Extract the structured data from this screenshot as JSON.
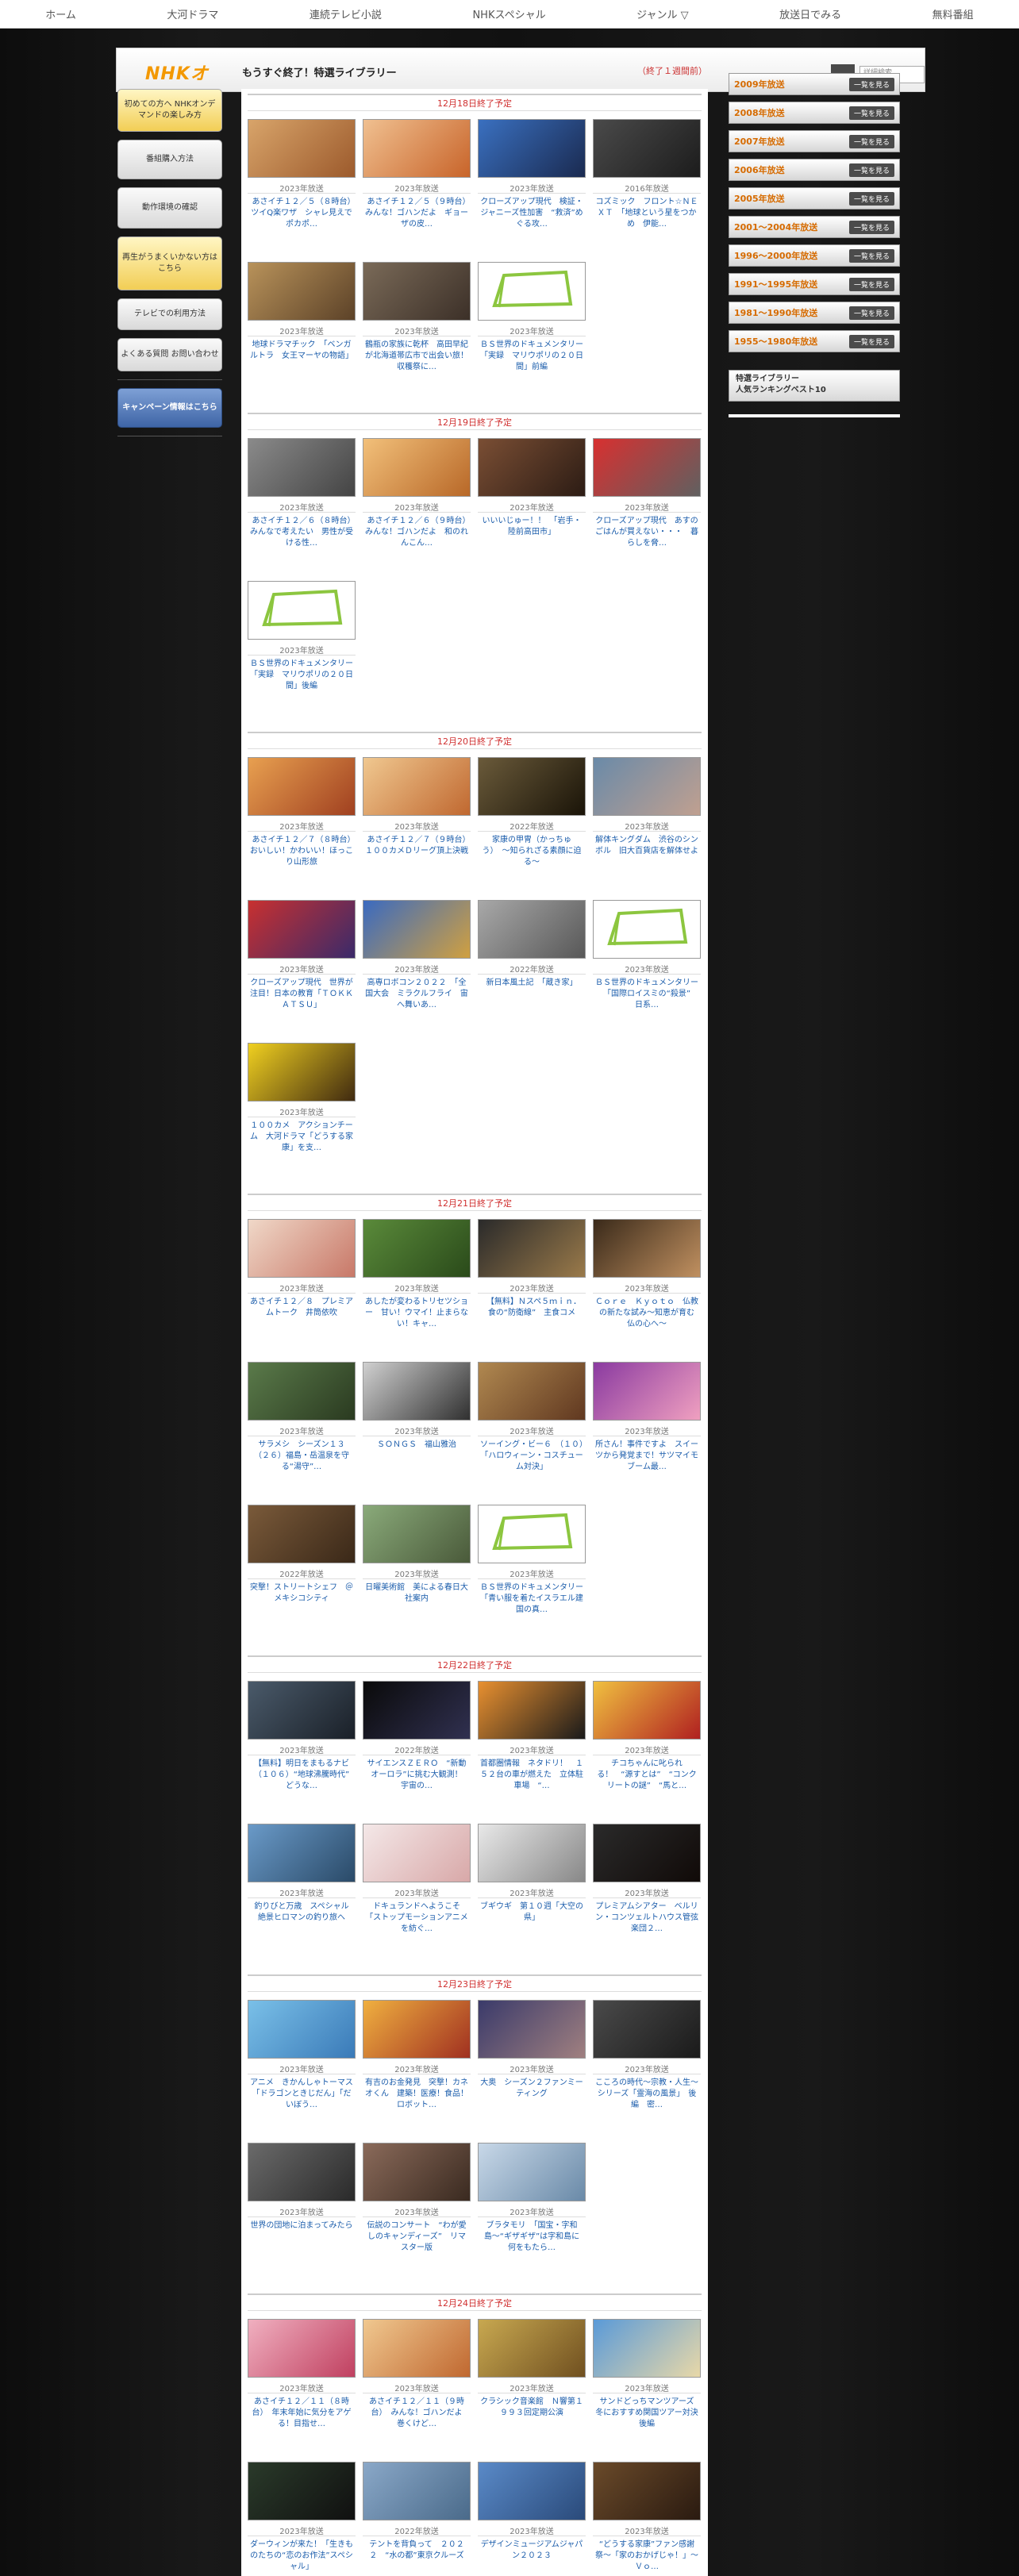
{
  "topnav": [
    "ホーム",
    "大河ドラマ",
    "連続テレビ小説",
    "NHKスペシャル",
    "ジャンル",
    "放送日でみる",
    "無料番組"
  ],
  "header": {
    "logo": "NHKオ",
    "title": "もうすぐ終了！特選ライブラリー",
    "sub": "（終了１週間前）",
    "search_placeholder": "詳細検索"
  },
  "sidebar": [
    "初めての方へ NHKオンデマンドの楽しみ方",
    "番組購入方法",
    "動作環境の確認",
    "再生がうまくいかない方はこちら",
    "テレビでの利用方法",
    "よくある質問 お問い合わせ",
    "キャンペーン情報はこちら"
  ],
  "rightnav": {
    "years": [
      "2009年放送",
      "2008年放送",
      "2007年放送",
      "2006年放送",
      "2005年放送",
      "2001〜2004年放送",
      "1996〜2000年放送",
      "1991〜1995年放送",
      "1981〜1990年放送",
      "1955〜1980年放送"
    ],
    "button": "一覧を見る",
    "ranking_l1": "特選ライブラリー",
    "ranking_l2": "人気ランキングベスト10"
  },
  "days": [
    {
      "label": "12月18日終了予定",
      "items": [
        {
          "year": "2023年放送",
          "title": "あさイチ１２／５（８時台）　ツイQ楽ワザ　シャレ見えでポカポ…",
          "c1": "#d8a46a",
          "c2": "#9c5a2c"
        },
        {
          "year": "2023年放送",
          "title": "あさイチ１２／５（９時台）　みんな！ゴハンだよ　ギョーザの皮…",
          "c1": "#f0c090",
          "c2": "#c8642a"
        },
        {
          "year": "2023年放送",
          "title": "クローズアップ現代　検証・ジャニーズ性加害　“救済”めぐる攻…",
          "c1": "#3a70c0",
          "c2": "#1a2a50"
        },
        {
          "year": "2016年放送",
          "title": "コズミック　フロント☆ＮＥＸＴ　「地球という星をつかめ　伊能…",
          "c1": "#4a4a4a",
          "c2": "#1c1c1c"
        },
        {
          "year": "2023年放送",
          "title": "地球ドラマチック　「ベンガルトラ　女王マーヤの物語」",
          "c1": "#b8925a",
          "c2": "#5c4228"
        },
        {
          "year": "2023年放送",
          "title": "鶴瓶の家族に乾杯　高田早紀が北海道帯広市で出会い旅！収穫祭に…",
          "c1": "#7a6a58",
          "c2": "#3c3028"
        },
        {
          "year": "2023年放送",
          "title": "ＢＳ世界のドキュメンタリー　「実録　マリウポリの２０日間」前編",
          "doc": "true"
        }
      ]
    },
    {
      "label": "12月19日終了予定",
      "items": [
        {
          "year": "2023年放送",
          "title": "あさイチ１２／６（８時台）　みんなで考えたい　男性が受ける性…",
          "c1": "#8a8a8a",
          "c2": "#444"
        },
        {
          "year": "2023年放送",
          "title": "あさイチ１２／６（９時台）　みんな！ゴハンだよ　和のれんこん…",
          "c1": "#f2c07a",
          "c2": "#b86828"
        },
        {
          "year": "2023年放送",
          "title": "いいいじゅー！！　「岩手・陸前高田市」",
          "c1": "#7a4e34",
          "c2": "#2c1c14"
        },
        {
          "year": "2023年放送",
          "title": "クローズアップ現代　あすのごはんが買えない・・・　暮らしを脅…",
          "c1": "#d83030",
          "c2": "#606060"
        },
        {
          "year": "2023年放送",
          "title": "ＢＳ世界のドキュメンタリー　「実録　マリウポリの２０日間」後編",
          "doc": "true"
        }
      ]
    },
    {
      "label": "12月20日終了予定",
      "items": [
        {
          "year": "2023年放送",
          "title": "あさイチ１２／７（８時台）　おいしい！かわいい！ほっこり山形旅",
          "c1": "#e8a050",
          "c2": "#a04020"
        },
        {
          "year": "2023年放送",
          "title": "あさイチ１２／７（９時台）　１００カメＤリーグ頂上決戦",
          "c1": "#f0c890",
          "c2": "#c06830"
        },
        {
          "year": "2022年放送",
          "title": "家康の甲冑（かっちゅう）　〜知られざる素顔に迫る〜",
          "c1": "#6a5a3a",
          "c2": "#1a1408"
        },
        {
          "year": "2023年放送",
          "title": "解体キングダム　渋谷のシンボル　旧大百貨店を解体せよ",
          "c1": "#6a8aa8",
          "c2": "#c0a090"
        },
        {
          "year": "2023年放送",
          "title": "クローズアップ現代　世界が注目！日本の教育「ＴＯＫＫＡＴＳＵ」",
          "c1": "#c83030",
          "c2": "#3a2a6a"
        },
        {
          "year": "2023年放送",
          "title": "高専ロボコン２０２２　「全国大会　ミラクルフライ　宙へ舞いあ…",
          "c1": "#3a6ac0",
          "c2": "#d0a040"
        },
        {
          "year": "2022年放送",
          "title": "新日本風土記　「蔵き家」",
          "c1": "#a8a8a8",
          "c2": "#585858"
        },
        {
          "year": "2023年放送",
          "title": "ＢＳ世界のドキュメンタリー　「国際ロイスミの“殺景”　日系…",
          "doc": "true"
        },
        {
          "year": "2023年放送",
          "title": "１００カメ　アクションチーム　大河ドラマ「どうする家康」を支…",
          "c1": "#f0d020",
          "c2": "#402a10"
        }
      ]
    },
    {
      "label": "12月21日終了予定",
      "items": [
        {
          "year": "2023年放送",
          "title": "あさイチ１２／８　プレミアムトーク　井筒依吹",
          "c1": "#f0d8c8",
          "c2": "#c87868"
        },
        {
          "year": "2023年放送",
          "title": "あしたが変わるトリセツショー　甘い！ウマイ！止まらない！キャ…",
          "c1": "#5a8a3a",
          "c2": "#2a4a1a"
        },
        {
          "year": "2023年放送",
          "title": "【無料】Ｎスペ５ｍｉｎ．　食の“防衛線”　主食コメ",
          "c1": "#2a2a2a",
          "c2": "#9a7a4a"
        },
        {
          "year": "2023年放送",
          "title": "Ｃｏｒｅ　Ｋｙｏｔｏ　仏教の新たな試み〜知恵が育む　仏の心へ〜",
          "c1": "#3a2a1a",
          "c2": "#c09060"
        },
        {
          "year": "2023年放送",
          "title": "サラメシ　シーズン１３　（２６）福島・岳温泉を守る“湯守”…",
          "c1": "#5a7a4a",
          "c2": "#2a3a20"
        },
        {
          "year": "2023年放送",
          "title": "ＳＯＮＧＳ　福山雅治",
          "c1": "#d0d0d0",
          "c2": "#303030"
        },
        {
          "year": "2023年放送",
          "title": "ソーイング・ビー６　（１０）「ハロウィーン・コスチューム対決」",
          "c1": "#b08850",
          "c2": "#603820"
        },
        {
          "year": "2023年放送",
          "title": "所さん！事件ですよ　スイーツから発覚まで！サツマイモブーム最…",
          "c1": "#8a3aa0",
          "c2": "#f0a0c0"
        },
        {
          "year": "2022年放送",
          "title": "突撃！ストリートシェフ　＠メキシコシティ",
          "c1": "#7a5a3a",
          "c2": "#3a2818"
        },
        {
          "year": "2023年放送",
          "title": "日曜美術館　美による春日大社案内",
          "c1": "#8aaa7a",
          "c2": "#4a5a3a"
        },
        {
          "year": "2023年放送",
          "title": "ＢＳ世界のドキュメンタリー　「青い服を着たイスラエル建国の真…",
          "doc": "true"
        }
      ]
    },
    {
      "label": "12月22日終了予定",
      "items": [
        {
          "year": "2023年放送",
          "title": "【無料】明日をまもるナビ　（１０６）“地球沸騰時代”　どうな…",
          "c1": "#4a5a6a",
          "c2": "#1a2028"
        },
        {
          "year": "2022年放送",
          "title": "サイエンスＺＥＲＯ　“新動オーロラ”に挑む大観測！　宇宙の…",
          "c1": "#0a0a0a",
          "c2": "#303050"
        },
        {
          "year": "2023年放送",
          "title": "首都圏情報　ネタドリ！　１５２台の車が燃えた　立体駐車場　“…",
          "c1": "#e89030",
          "c2": "#1a1a1a"
        },
        {
          "year": "2023年放送",
          "title": "チコちゃんに叱られる！　“源すとは”　“コンクリートの謎”　“馬と…",
          "c1": "#f0c040",
          "c2": "#b02020"
        },
        {
          "year": "2023年放送",
          "title": "釣りびと万歳　スペシャル　絶景ヒロマンの釣り旅へ",
          "c1": "#6a9ac8",
          "c2": "#2a4a68"
        },
        {
          "year": "2023年放送",
          "title": "ドキュランドへようこそ　「ストップモーションアニメを紡ぐ…",
          "c1": "#f4e8e8",
          "c2": "#d8a8a8"
        },
        {
          "year": "2023年放送",
          "title": "ブギウギ　第１０週「大空の県」",
          "c1": "#e8e8e8",
          "c2": "#888"
        },
        {
          "year": "2023年放送",
          "title": "プレミアムシアター　ベルリン・コンツェルトハウス管弦楽団２…",
          "c1": "#2a2a2a",
          "c2": "#100a08"
        }
      ]
    },
    {
      "label": "12月23日終了予定",
      "items": [
        {
          "year": "2023年放送",
          "title": "アニメ　きかんしゃトーマス　「ドラゴンときじだん」「だいぼう…",
          "c1": "#7ac0e8",
          "c2": "#3a7ab8"
        },
        {
          "year": "2023年放送",
          "title": "有吉のお金発見　突撃！カネオくん　建築！医療！食品！ロボット…",
          "c1": "#f0b040",
          "c2": "#a03020"
        },
        {
          "year": "2023年放送",
          "title": "大奥　シーズン２ファンミーティング",
          "c1": "#3a3a6a",
          "c2": "#a08080"
        },
        {
          "year": "2023年放送",
          "title": "こころの時代〜宗教・人生〜　シリーズ「霊海の風景」　後編　密…",
          "c1": "#4a4a4a",
          "c2": "#1a1a1a"
        },
        {
          "year": "2023年放送",
          "title": "世界の団地に泊まってみたら",
          "c1": "#6a6a6a",
          "c2": "#2a2a2a"
        },
        {
          "year": "2023年放送",
          "title": "伝説のコンサート　“わが愛しのキャンディーズ”　リマスター版",
          "c1": "#8a6a5a",
          "c2": "#3a2a20"
        },
        {
          "year": "2023年放送",
          "title": "ブラタモリ　「国宝・字和島〜“ギザギザ”は字和島に何をもたら…",
          "c1": "#c8d8e8",
          "c2": "#6a8aa8"
        }
      ]
    },
    {
      "label": "12月24日終了予定",
      "items": [
        {
          "year": "2023年放送",
          "title": "あさイチ１２／１１（８時台）　年末年始に気分をアゲる！目指せ…",
          "c1": "#f0b0c0",
          "c2": "#c04060"
        },
        {
          "year": "2023年放送",
          "title": "あさイチ１２／１１（９時台）　みんな！ゴハンだよ　巻くけど…",
          "c1": "#f0c890",
          "c2": "#c06830"
        },
        {
          "year": "2023年放送",
          "title": "クラシック音楽館　Ｎ響第１９９３回定期公演",
          "c1": "#c8a850",
          "c2": "#705020"
        },
        {
          "year": "2023年放送",
          "title": "サンドどっちマンツアーズ　冬におすすめ関国ツアー対決　後編",
          "c1": "#5a9ad8",
          "c2": "#e8d8a8"
        },
        {
          "year": "2023年放送",
          "title": "ダーウィンが来た！「生きものたちの“恋のお作法”スペシャル」",
          "c1": "#2a3a2a",
          "c2": "#101010"
        },
        {
          "year": "2022年放送",
          "title": "テントを背負って　２０２２　“水の都”東京クルーズ",
          "c1": "#8aa8c8",
          "c2": "#4a6a8a"
        },
        {
          "year": "2023年放送",
          "title": "デザインミュージアムジャパン２０２３",
          "c1": "#5a8ac8",
          "c2": "#2a4a7a"
        },
        {
          "year": "2023年放送",
          "title": "“どうする家康”ファン感謝祭〜「家のおかげじゃ！」〜　Ｖｏ…",
          "c1": "#6a4a2a",
          "c2": "#2a1a10"
        }
      ]
    }
  ]
}
